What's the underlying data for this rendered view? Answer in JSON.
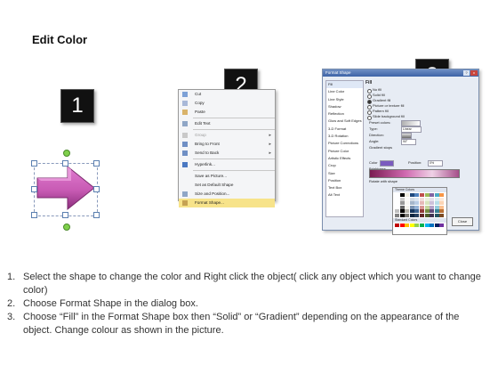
{
  "title": "Edit Color",
  "badges": [
    "1",
    "2",
    "3"
  ],
  "context_menu": {
    "items": [
      {
        "label": "Cut",
        "submenu": false
      },
      {
        "label": "Copy",
        "submenu": false
      },
      {
        "label": "Paste",
        "submenu": false
      },
      {
        "label": "Edit Text",
        "submenu": false
      },
      {
        "label": "Group",
        "submenu": true
      },
      {
        "label": "Bring to Front",
        "submenu": true
      },
      {
        "label": "Send to Back",
        "submenu": true
      },
      {
        "label": "Hyperlink...",
        "submenu": false
      },
      {
        "label": "Save as Picture...",
        "submenu": false
      },
      {
        "label": "Set as Default Shape",
        "submenu": false
      },
      {
        "label": "Size and Position...",
        "submenu": false
      },
      {
        "label": "Format Shape...",
        "submenu": false,
        "highlighted": true
      }
    ]
  },
  "format_dialog": {
    "title": "Format Shape",
    "help": "?",
    "close_x": "x",
    "side_items": [
      "Fill",
      "Line Color",
      "Line Style",
      "Shadow",
      "Reflection",
      "Glow and Soft Edges",
      "3-D Format",
      "3-D Rotation",
      "Picture Corrections",
      "Picture Color",
      "Artistic Effects",
      "Crop",
      "Size",
      "Position",
      "Text Box",
      "Alt Text"
    ],
    "fill_heading": "Fill",
    "fill_options": [
      {
        "label": "No fill",
        "selected": false
      },
      {
        "label": "Solid fill",
        "selected": false
      },
      {
        "label": "Gradient fill",
        "selected": true
      },
      {
        "label": "Picture or texture fill",
        "selected": false
      },
      {
        "label": "Pattern fill",
        "selected": false
      },
      {
        "label": "Slide background fill",
        "selected": false
      }
    ],
    "rows": [
      "Preset colors:",
      "Type:",
      "Direction:",
      "Angle:",
      "Gradient stops"
    ],
    "type_value": "Linear",
    "angle_value": "90°",
    "color_label": "Color",
    "position_label": "Position:",
    "position_value": "0%",
    "brightness_label": "Brightness",
    "transparency_label": "Transparency",
    "rotate_label": "Rotate with shape",
    "close_button": "Close"
  },
  "palette": {
    "theme_label": "Theme Colors",
    "standard_label": "Standard Colors",
    "colors": {
      "theme": [
        "#ffffff",
        "#000000",
        "#eeece1",
        "#1f497d",
        "#4f81bd",
        "#c0504d",
        "#9bbb59",
        "#8064a2",
        "#4bacc6",
        "#f79646"
      ],
      "standard": [
        "#c00000",
        "#ff0000",
        "#ffc000",
        "#ffff00",
        "#92d050",
        "#00b050",
        "#00b0f0",
        "#0070c0",
        "#002060",
        "#7030a0"
      ]
    }
  },
  "steps": [
    {
      "num": "1.",
      "text": "Select the shape to change the color and Right click the object( click any object which you want to change color)"
    },
    {
      "num": "2.",
      "text": "Choose Format Shape in the dialog box."
    },
    {
      "num": "3.",
      "text": "Choose “Fill” in the Format Shape box then “Solid” or “Gradient” depending on the appearance of the object. Change colour as shown in the picture."
    }
  ],
  "colors": {
    "arrow": "#c85bb4",
    "arrow_dark": "#8c2f7d",
    "menu_highlight": "#f7e38a"
  }
}
